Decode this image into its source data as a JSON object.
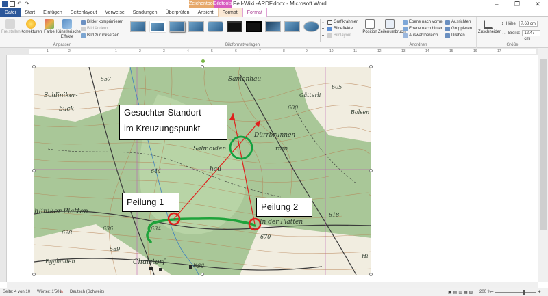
{
  "window": {
    "title": "Peil-Wiki -ARDF.docx - Microsoft Word",
    "context_tools": "Zeichentools",
    "context_picture": "Bildtools",
    "controls": [
      "–",
      "❐",
      "✕"
    ]
  },
  "tabs": [
    "Datei",
    "Start",
    "Einfügen",
    "Seitenlayout",
    "Verweise",
    "Sendungen",
    "Überprüfen",
    "Ansicht",
    "Format",
    "Format"
  ],
  "ribbon": {
    "adjust": {
      "label": "Anpassen",
      "freistellen": "Freistellen",
      "korrekturen": "Korrekturen",
      "farbe": "Farbe",
      "kuenstlerisch": "Künstlerische Effekte",
      "komprimieren": "Bilder komprimieren",
      "aendern": "Bild ändern",
      "zuruecksetzen": "Bild zurücksetzen"
    },
    "styles": {
      "label": "Bildformatvorlagen",
      "grafikrahmen": "Grafikrahmen",
      "bildeffekte": "Bildeffekte",
      "bildlayout": "Bildlayout"
    },
    "arrange": {
      "label": "Anordnen",
      "position": "Position",
      "zeilenumbruch": "Zeilenumbruch",
      "vorne": "Ebene nach vorne",
      "hinten": "Ebene nach hinten",
      "auswahl": "Auswahlbereich",
      "ausrichten": "Ausrichten",
      "gruppieren": "Gruppieren",
      "drehen": "Drehen"
    },
    "size": {
      "label": "Größe",
      "zuschneiden": "Zuschneiden",
      "hoehe_label": "Höhe:",
      "hoehe": "7.68 cm",
      "breite_label": "Breite:",
      "breite": "12.47 cm"
    }
  },
  "ruler": [
    "1",
    "2",
    "1",
    "2",
    "3",
    "4",
    "5",
    "6",
    "7",
    "8",
    "9",
    "10",
    "11",
    "12",
    "13",
    "14",
    "15",
    "16",
    "17"
  ],
  "map": {
    "callout_title_line1": "Gesuchter Standort",
    "callout_title_line2": "im Kreuzungspunkt",
    "bearing1": "Peilung 1",
    "bearing2": "Peilung 2",
    "labels": {
      "samenhau": "Samenhau",
      "gaetterli": "Gätterli",
      "schliniker": "Schliniker-",
      "buck": "buck",
      "duerrbrunnen": "Dürrbrunnen-",
      "rain": "rain",
      "salmoiden": "Salmoiden",
      "hau": "hau",
      "platten": "hliniker Platten",
      "inderplatten": "In der Platten",
      "chalstorf": "Chalstorf",
      "egghalden": "Egghalden",
      "egg": "Egg",
      "bolsen": "Bolsen",
      "hi": "Hi",
      "n557": "557",
      "n605": "605",
      "n600": "600",
      "n644": "644",
      "n636": "636",
      "n634": "634",
      "n670": "670",
      "n628": "628",
      "n589": "589",
      "n618": "618"
    }
  },
  "status": {
    "page": "Seite: 4 von 10",
    "words": "Wörter: 1'501",
    "language": "Deutsch (Schweiz)",
    "zoom": "200 %"
  },
  "colors": {
    "file_tab": "#2b579a",
    "map_green": "#a7c596",
    "bearing_red": "#e0201c",
    "target_green": "#12a040",
    "path_green": "#1fa33b"
  }
}
